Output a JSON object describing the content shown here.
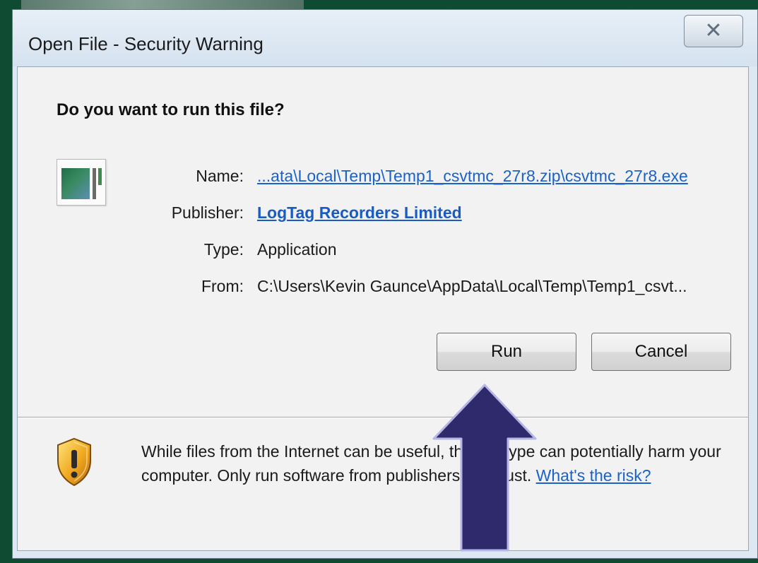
{
  "window": {
    "title": "Open File - Security Warning",
    "close_glyph": "✕"
  },
  "dialog": {
    "question": "Do you want to run this file?",
    "fields": {
      "name_label": "Name:",
      "name_value": "...ata\\Local\\Temp\\Temp1_csvtmc_27r8.zip\\csvtmc_27r8.exe",
      "publisher_label": "Publisher:",
      "publisher_value": "LogTag Recorders Limited",
      "type_label": "Type:",
      "type_value": "Application",
      "from_label": "From:",
      "from_value": "C:\\Users\\Kevin Gaunce\\AppData\\Local\\Temp\\Temp1_csvt..."
    },
    "buttons": {
      "run": "Run",
      "cancel": "Cancel"
    },
    "warning": {
      "text": "While files from the Internet can be useful, this file type can potentially harm your computer. Only run software from publishers you trust.",
      "link": "What's the risk?"
    }
  },
  "icons": {
    "app": "application-icon",
    "shield": "shield-warning-icon",
    "arrow": "arrow-up-icon"
  },
  "colors": {
    "background": "#0f4a33",
    "link": "#1a62c9",
    "arrow_fill": "#2e2a6b",
    "arrow_stroke": "#b7b4e6"
  }
}
